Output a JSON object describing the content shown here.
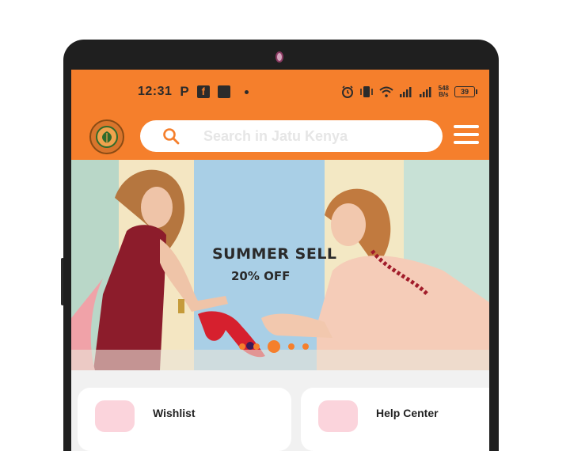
{
  "status_bar": {
    "time": "12:31",
    "net_speed_value": "548",
    "net_speed_unit": "B/s",
    "battery": "39"
  },
  "header": {
    "search_placeholder": "Search in Jatu Kenya"
  },
  "banner": {
    "title": "SUMMER SELL",
    "subtitle": "20% OFF",
    "pager": {
      "count": 5,
      "active_index": 2
    }
  },
  "colors": {
    "accent": "#f57f2c",
    "search_bg": "#ffffff",
    "card_icon_bg": "#fbd4dc"
  },
  "icons": [
    "search-icon",
    "menu-icon",
    "alarm-icon",
    "vibrate-icon",
    "wifi-icon",
    "signal-icon",
    "battery-icon",
    "facebook-icon",
    "parking-icon"
  ],
  "cards": [
    {
      "label": "Wishlist"
    },
    {
      "label": "Help Center"
    }
  ]
}
